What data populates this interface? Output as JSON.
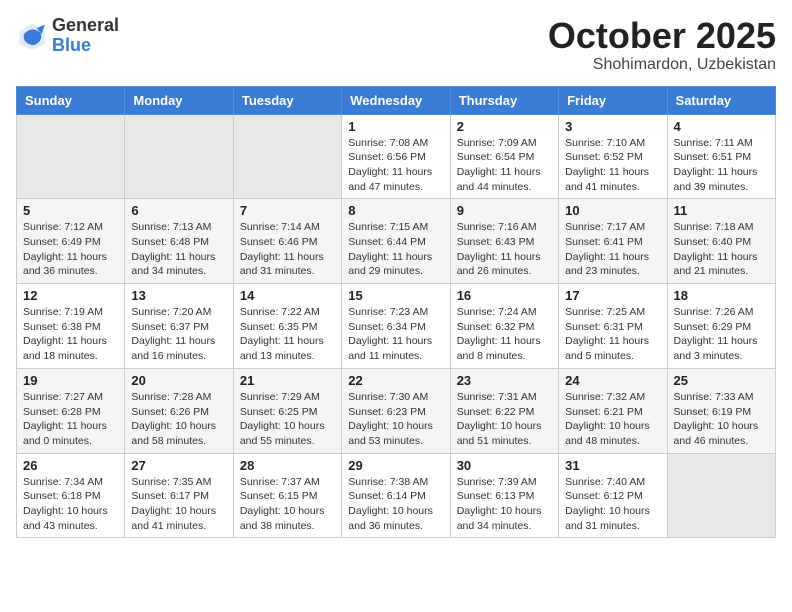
{
  "header": {
    "logo": {
      "general": "General",
      "blue": "Blue"
    },
    "month": "October 2025",
    "location": "Shohimardon, Uzbekistan"
  },
  "weekdays": [
    "Sunday",
    "Monday",
    "Tuesday",
    "Wednesday",
    "Thursday",
    "Friday",
    "Saturday"
  ],
  "weeks": [
    [
      {
        "day": "",
        "info": ""
      },
      {
        "day": "",
        "info": ""
      },
      {
        "day": "",
        "info": ""
      },
      {
        "day": "1",
        "info": "Sunrise: 7:08 AM\nSunset: 6:56 PM\nDaylight: 11 hours and 47 minutes."
      },
      {
        "day": "2",
        "info": "Sunrise: 7:09 AM\nSunset: 6:54 PM\nDaylight: 11 hours and 44 minutes."
      },
      {
        "day": "3",
        "info": "Sunrise: 7:10 AM\nSunset: 6:52 PM\nDaylight: 11 hours and 41 minutes."
      },
      {
        "day": "4",
        "info": "Sunrise: 7:11 AM\nSunset: 6:51 PM\nDaylight: 11 hours and 39 minutes."
      }
    ],
    [
      {
        "day": "5",
        "info": "Sunrise: 7:12 AM\nSunset: 6:49 PM\nDaylight: 11 hours and 36 minutes."
      },
      {
        "day": "6",
        "info": "Sunrise: 7:13 AM\nSunset: 6:48 PM\nDaylight: 11 hours and 34 minutes."
      },
      {
        "day": "7",
        "info": "Sunrise: 7:14 AM\nSunset: 6:46 PM\nDaylight: 11 hours and 31 minutes."
      },
      {
        "day": "8",
        "info": "Sunrise: 7:15 AM\nSunset: 6:44 PM\nDaylight: 11 hours and 29 minutes."
      },
      {
        "day": "9",
        "info": "Sunrise: 7:16 AM\nSunset: 6:43 PM\nDaylight: 11 hours and 26 minutes."
      },
      {
        "day": "10",
        "info": "Sunrise: 7:17 AM\nSunset: 6:41 PM\nDaylight: 11 hours and 23 minutes."
      },
      {
        "day": "11",
        "info": "Sunrise: 7:18 AM\nSunset: 6:40 PM\nDaylight: 11 hours and 21 minutes."
      }
    ],
    [
      {
        "day": "12",
        "info": "Sunrise: 7:19 AM\nSunset: 6:38 PM\nDaylight: 11 hours and 18 minutes."
      },
      {
        "day": "13",
        "info": "Sunrise: 7:20 AM\nSunset: 6:37 PM\nDaylight: 11 hours and 16 minutes."
      },
      {
        "day": "14",
        "info": "Sunrise: 7:22 AM\nSunset: 6:35 PM\nDaylight: 11 hours and 13 minutes."
      },
      {
        "day": "15",
        "info": "Sunrise: 7:23 AM\nSunset: 6:34 PM\nDaylight: 11 hours and 11 minutes."
      },
      {
        "day": "16",
        "info": "Sunrise: 7:24 AM\nSunset: 6:32 PM\nDaylight: 11 hours and 8 minutes."
      },
      {
        "day": "17",
        "info": "Sunrise: 7:25 AM\nSunset: 6:31 PM\nDaylight: 11 hours and 5 minutes."
      },
      {
        "day": "18",
        "info": "Sunrise: 7:26 AM\nSunset: 6:29 PM\nDaylight: 11 hours and 3 minutes."
      }
    ],
    [
      {
        "day": "19",
        "info": "Sunrise: 7:27 AM\nSunset: 6:28 PM\nDaylight: 11 hours and 0 minutes."
      },
      {
        "day": "20",
        "info": "Sunrise: 7:28 AM\nSunset: 6:26 PM\nDaylight: 10 hours and 58 minutes."
      },
      {
        "day": "21",
        "info": "Sunrise: 7:29 AM\nSunset: 6:25 PM\nDaylight: 10 hours and 55 minutes."
      },
      {
        "day": "22",
        "info": "Sunrise: 7:30 AM\nSunset: 6:23 PM\nDaylight: 10 hours and 53 minutes."
      },
      {
        "day": "23",
        "info": "Sunrise: 7:31 AM\nSunset: 6:22 PM\nDaylight: 10 hours and 51 minutes."
      },
      {
        "day": "24",
        "info": "Sunrise: 7:32 AM\nSunset: 6:21 PM\nDaylight: 10 hours and 48 minutes."
      },
      {
        "day": "25",
        "info": "Sunrise: 7:33 AM\nSunset: 6:19 PM\nDaylight: 10 hours and 46 minutes."
      }
    ],
    [
      {
        "day": "26",
        "info": "Sunrise: 7:34 AM\nSunset: 6:18 PM\nDaylight: 10 hours and 43 minutes."
      },
      {
        "day": "27",
        "info": "Sunrise: 7:35 AM\nSunset: 6:17 PM\nDaylight: 10 hours and 41 minutes."
      },
      {
        "day": "28",
        "info": "Sunrise: 7:37 AM\nSunset: 6:15 PM\nDaylight: 10 hours and 38 minutes."
      },
      {
        "day": "29",
        "info": "Sunrise: 7:38 AM\nSunset: 6:14 PM\nDaylight: 10 hours and 36 minutes."
      },
      {
        "day": "30",
        "info": "Sunrise: 7:39 AM\nSunset: 6:13 PM\nDaylight: 10 hours and 34 minutes."
      },
      {
        "day": "31",
        "info": "Sunrise: 7:40 AM\nSunset: 6:12 PM\nDaylight: 10 hours and 31 minutes."
      },
      {
        "day": "",
        "info": ""
      }
    ]
  ]
}
